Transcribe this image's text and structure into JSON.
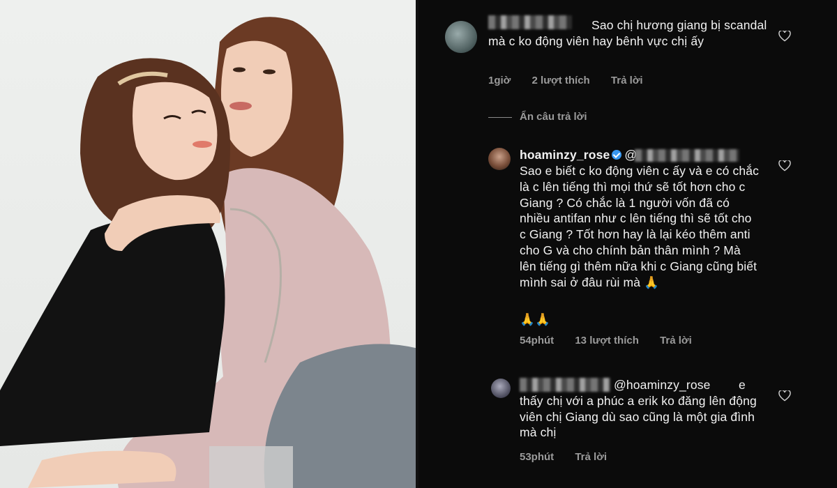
{
  "photo": {
    "description_icon": "photo-of-two-women"
  },
  "comments": [
    {
      "username": "",
      "text": "Sao chị hương giang bị scandal mà c ko động viên hay bênh vực chị ấy",
      "time": "1giờ",
      "likes": "2 lượt thích",
      "reply": "Trả lời"
    },
    {
      "username": "hoaminzy_rose",
      "mention": "@",
      "text": "Sao e biết c ko động viên c ấy và e có chắc là c lên tiếng thì mọi thứ sẽ tốt hơn cho c Giang ? Có chắc là 1 người vốn đã có nhiều antifan như c lên tiếng thì sẽ tốt cho c Giang ? Tốt hơn hay là lại kéo thêm anti cho G và cho chính bản thân mình ? Mà lên tiếng gì thêm nữa khi c Giang cũng biết mình sai ở đâu rùi mà 🙏",
      "text_last": "🙏🙏",
      "time": "54phút",
      "likes": "13 lượt thích",
      "reply": "Trả lời"
    },
    {
      "username": "",
      "mention": "@hoaminzy_rose",
      "text": "e thấy chị với a phúc a erik ko đăng lên động viên chị Giang dù sao cũng là một gia đình mà chị",
      "time": "53phút",
      "reply": "Trả lời"
    }
  ],
  "hide_replies": "Ẩn câu trả lời",
  "colors": {
    "background": "#0b0b0b",
    "text": "#f2f2f2",
    "meta": "#9b9b9b",
    "verified": "#3897f0"
  }
}
